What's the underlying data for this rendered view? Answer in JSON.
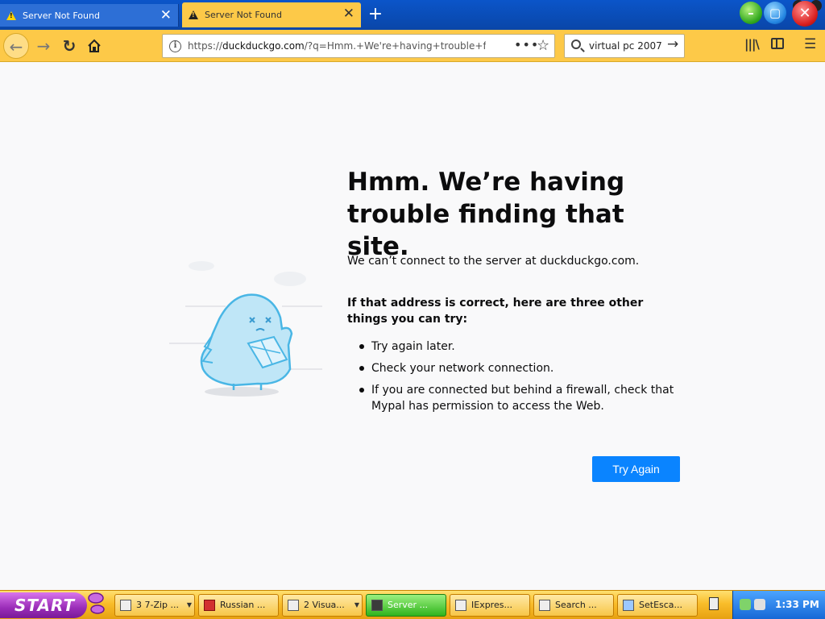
{
  "browser": {
    "tabs": [
      {
        "title": "Server Not Found",
        "active": false
      },
      {
        "title": "Server Not Found",
        "active": true
      }
    ],
    "new_tab_symbol": "+",
    "url": "https://duckduckgo.com/?q=Hmm.+We're+having+trouble+fin",
    "url_host": "duckduckgo.com",
    "url_prefix": "https://",
    "url_rest": "/?q=Hmm.+We're+having+trouble+fin",
    "search_value": "virtual pc 2007",
    "page_actions_symbol": "•••"
  },
  "error_page": {
    "title": "Hmm. We’re having trouble finding that site.",
    "description": "We can’t connect to the server at duckduckgo.com.",
    "hint": "If that address is correct, here are three other things you can try:",
    "tips": [
      "Try again later.",
      "Check your network connection.",
      "If you are connected but behind a firewall, check that Mypal has permission to access the Web."
    ],
    "button_label": "Try Again"
  },
  "taskbar": {
    "start_label": "START",
    "tasks": [
      {
        "label": "3 7-Zip ...",
        "has_menu": true
      },
      {
        "label": "Russian ...",
        "has_menu": false
      },
      {
        "label": "2 Visua...",
        "has_menu": true
      },
      {
        "label": "Server ...",
        "has_menu": false,
        "active": true
      },
      {
        "label": "IExpres...",
        "has_menu": false
      },
      {
        "label": "Search ...",
        "has_menu": false
      },
      {
        "label": "SetEsca...",
        "has_menu": false
      }
    ],
    "clock": "1:33 PM"
  },
  "colors": {
    "accent_blue": "#0a84ff",
    "nav_yellow": "#fdc948",
    "tabstrip_blue": "#0b55c9",
    "start_purple": "#9a2db8"
  }
}
